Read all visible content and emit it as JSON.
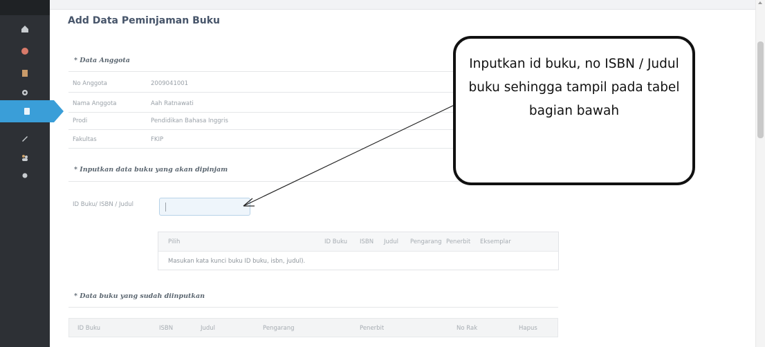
{
  "page": {
    "title": "Add Data Peminjaman Buku"
  },
  "sidebar": {
    "items": [
      {
        "icon": "home-icon",
        "active": false
      },
      {
        "icon": "chart-icon",
        "active": false
      },
      {
        "icon": "book-icon",
        "active": false
      },
      {
        "icon": "settings-icon",
        "active": false
      },
      {
        "icon": "document-icon",
        "active": true
      },
      {
        "icon": "pencil-icon",
        "active": false
      },
      {
        "icon": "users-icon",
        "active": false
      },
      {
        "icon": "gear-icon",
        "active": false
      }
    ]
  },
  "member_section": {
    "title": "* Data Anggota",
    "rows": [
      {
        "label": "No Anggota",
        "value": "2009041001"
      },
      {
        "label": "Nama Anggota",
        "value": "Aah Ratnawati"
      },
      {
        "label": "Prodi",
        "value": "Pendidikan Bahasa Inggris"
      },
      {
        "label": "Fakultas",
        "value": "FKIP"
      }
    ]
  },
  "book_input_section": {
    "title": "* Inputkan data buku yang akan dipinjam",
    "field_label": "ID Buku/ ISBN / Judul",
    "field_value": ""
  },
  "search_table": {
    "columns": [
      "Pilih",
      "ID Buku",
      "ISBN",
      "Judul",
      "Pengarang",
      "Penerbit",
      "Eksemplar"
    ],
    "empty_message": "Masukan kata kunci buku ID buku, isbn, judul)."
  },
  "saved_section": {
    "title": "* Data buku yang sudah diinputkan",
    "columns": [
      "ID Buku",
      "ISBN",
      "Judul",
      "Pengarang",
      "Penerbit",
      "No Rak",
      "Hapus"
    ]
  },
  "callout": {
    "text": "Inputkan id buku, no ISBN / Judul buku sehingga tampil pada tabel bagian bawah"
  },
  "colors": {
    "sidebar": "#2d3035",
    "active_accent": "#3a9ed8",
    "title_text": "#47556a"
  }
}
